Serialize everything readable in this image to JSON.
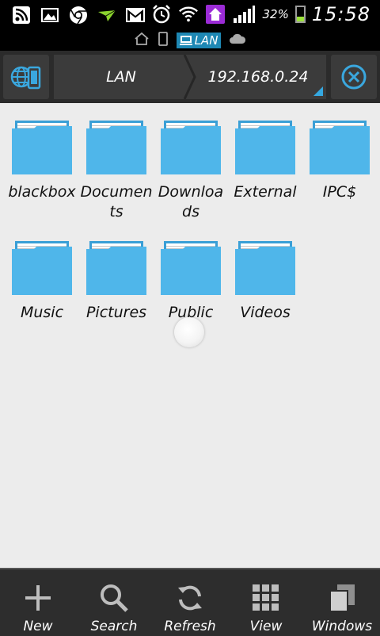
{
  "status_bar": {
    "battery_percent": "32%",
    "time": "15:58",
    "icons": [
      "rss-icon",
      "image-icon",
      "chrome-icon",
      "airplane-icon",
      "gmail-icon",
      "alarm-icon",
      "wifi-icon",
      "home-app-icon",
      "signal-icon"
    ]
  },
  "sub_bar": {
    "active_label": "LAN",
    "icons": [
      "home-icon",
      "phone-icon",
      "lan-icon",
      "cloud-icon"
    ]
  },
  "toolbar": {
    "crumbs": [
      "LAN",
      "192.168.0.24"
    ],
    "left_icon": "network-devices-icon",
    "right_icon": "close-circle-icon",
    "accent": "#35a8e0"
  },
  "folders": [
    {
      "name": "blackbox"
    },
    {
      "name": "Documents"
    },
    {
      "name": "Downloads"
    },
    {
      "name": "External"
    },
    {
      "name": "IPC$"
    },
    {
      "name": "Music"
    },
    {
      "name": "Pictures"
    },
    {
      "name": "Public"
    },
    {
      "name": "Videos"
    }
  ],
  "bottom_bar": {
    "items": [
      {
        "label": "New",
        "icon": "plus-icon"
      },
      {
        "label": "Search",
        "icon": "search-icon"
      },
      {
        "label": "Refresh",
        "icon": "refresh-icon"
      },
      {
        "label": "View",
        "icon": "grid-view-icon"
      },
      {
        "label": "Windows",
        "icon": "windows-icon"
      }
    ]
  },
  "colors": {
    "folder": "#4fb6ea",
    "folder_dark": "#3a9fd6",
    "background": "#ececec"
  }
}
